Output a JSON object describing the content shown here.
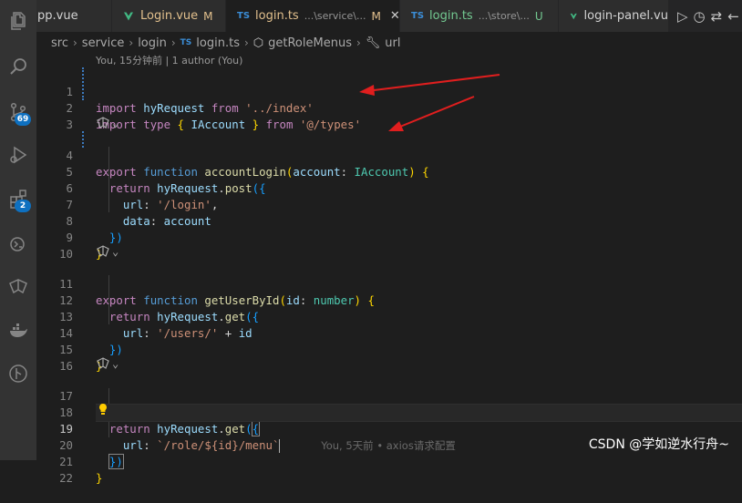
{
  "tabs": [
    {
      "name": "pp.vue",
      "kind": "vue",
      "color": "#d4d4d4"
    },
    {
      "name": "Login.vue",
      "kind": "vue",
      "mark": "M",
      "color": "#e2c08d"
    },
    {
      "name": "login.ts",
      "kind": "ts",
      "path": "...\\service\\...",
      "mark": "M",
      "close": "✕",
      "color": "#e2c08d"
    },
    {
      "name": "login.ts",
      "kind": "ts",
      "path": "...\\store\\...",
      "mark": "U",
      "color": "#73c991"
    },
    {
      "name": "login-panel.vu",
      "kind": "vue",
      "color": "#d4d4d4"
    }
  ],
  "breadcrumb": {
    "items": [
      "src",
      "service",
      "login",
      "login.ts",
      "getRoleMenus",
      "url"
    ],
    "ts_badge": "TS"
  },
  "blame_header": "You, 15分钟前 | 1 author (You)",
  "lines": {
    "l1": {
      "n": "1",
      "import": "import",
      "name": "hyRequest",
      "from": "from",
      "path": "'../index'"
    },
    "l2": {
      "n": "2",
      "import": "import",
      "type": "type",
      "ob": "{",
      "name": "IAccount",
      "cb": "}",
      "from": "from",
      "path": "'@/types'"
    },
    "l3": {
      "n": "3"
    },
    "l4": {
      "n": "4",
      "export": "export",
      "function": "function",
      "fname": "accountLogin",
      "p1": "(",
      "param": "account",
      "colon": ":",
      "ptype": "IAccount",
      "p2": ")",
      "brace": "{"
    },
    "l5": {
      "n": "5",
      "return": "return",
      "obj": "hyRequest",
      "dot": ".",
      "method": "post",
      "open": "({"
    },
    "l6": {
      "n": "6",
      "key": "url",
      "colon": ":",
      "value": "'/login'",
      "comma": ","
    },
    "l7": {
      "n": "7",
      "key": "data",
      "colon": ":",
      "value": "account"
    },
    "l8": {
      "n": "8",
      "close": "})"
    },
    "l9": {
      "n": "9",
      "close": "}"
    },
    "l10": {
      "n": "10"
    },
    "l11": {
      "n": "11",
      "export": "export",
      "function": "function",
      "fname": "getUserById",
      "p1": "(",
      "param": "id",
      "colon": ":",
      "ptype": "number",
      "p2": ")",
      "brace": "{"
    },
    "l12": {
      "n": "12",
      "return": "return",
      "obj": "hyRequest",
      "dot": ".",
      "method": "get",
      "open": "({"
    },
    "l13": {
      "n": "13",
      "key": "url",
      "colon": ":",
      "value": "'/users/'",
      "plus": "+",
      "var": "id"
    },
    "l14": {
      "n": "14",
      "close": "})"
    },
    "l15": {
      "n": "15",
      "close": "}"
    },
    "l16": {
      "n": "16"
    },
    "l17": {
      "n": "17",
      "export": "export",
      "function": "function",
      "fname": "getRoleMenus",
      "p1": "(",
      "param": "id",
      "colon": ":",
      "ptype": "number",
      "p2": ")",
      "brace": "{"
    },
    "l18": {
      "n": "18",
      "return": "return",
      "obj": "hyRequest",
      "dot": ".",
      "method": "get",
      "open": "(",
      "open2": "{"
    },
    "l19": {
      "n": "19",
      "key": "url",
      "colon": ":",
      "value": "`/role/${id}/menu`",
      "inline_blame": "You, 5天前 • axios请求配置"
    },
    "l20": {
      "n": "20",
      "close": "})"
    },
    "l21": {
      "n": "21",
      "close": "}"
    },
    "l22": {
      "n": "22"
    }
  },
  "activity_badges": {
    "source_control": "69",
    "extensions": "2"
  },
  "watermark": "CSDN @学如逆水行舟~",
  "colors": {
    "background": "#1e1e1e",
    "keyword": "#c586c0",
    "storage": "#569cd6",
    "function": "#dcdcaa",
    "variable": "#9cdcfe",
    "string": "#ce9178",
    "type": "#4ec9b0",
    "annotation_arrow": "#e01e1e"
  }
}
